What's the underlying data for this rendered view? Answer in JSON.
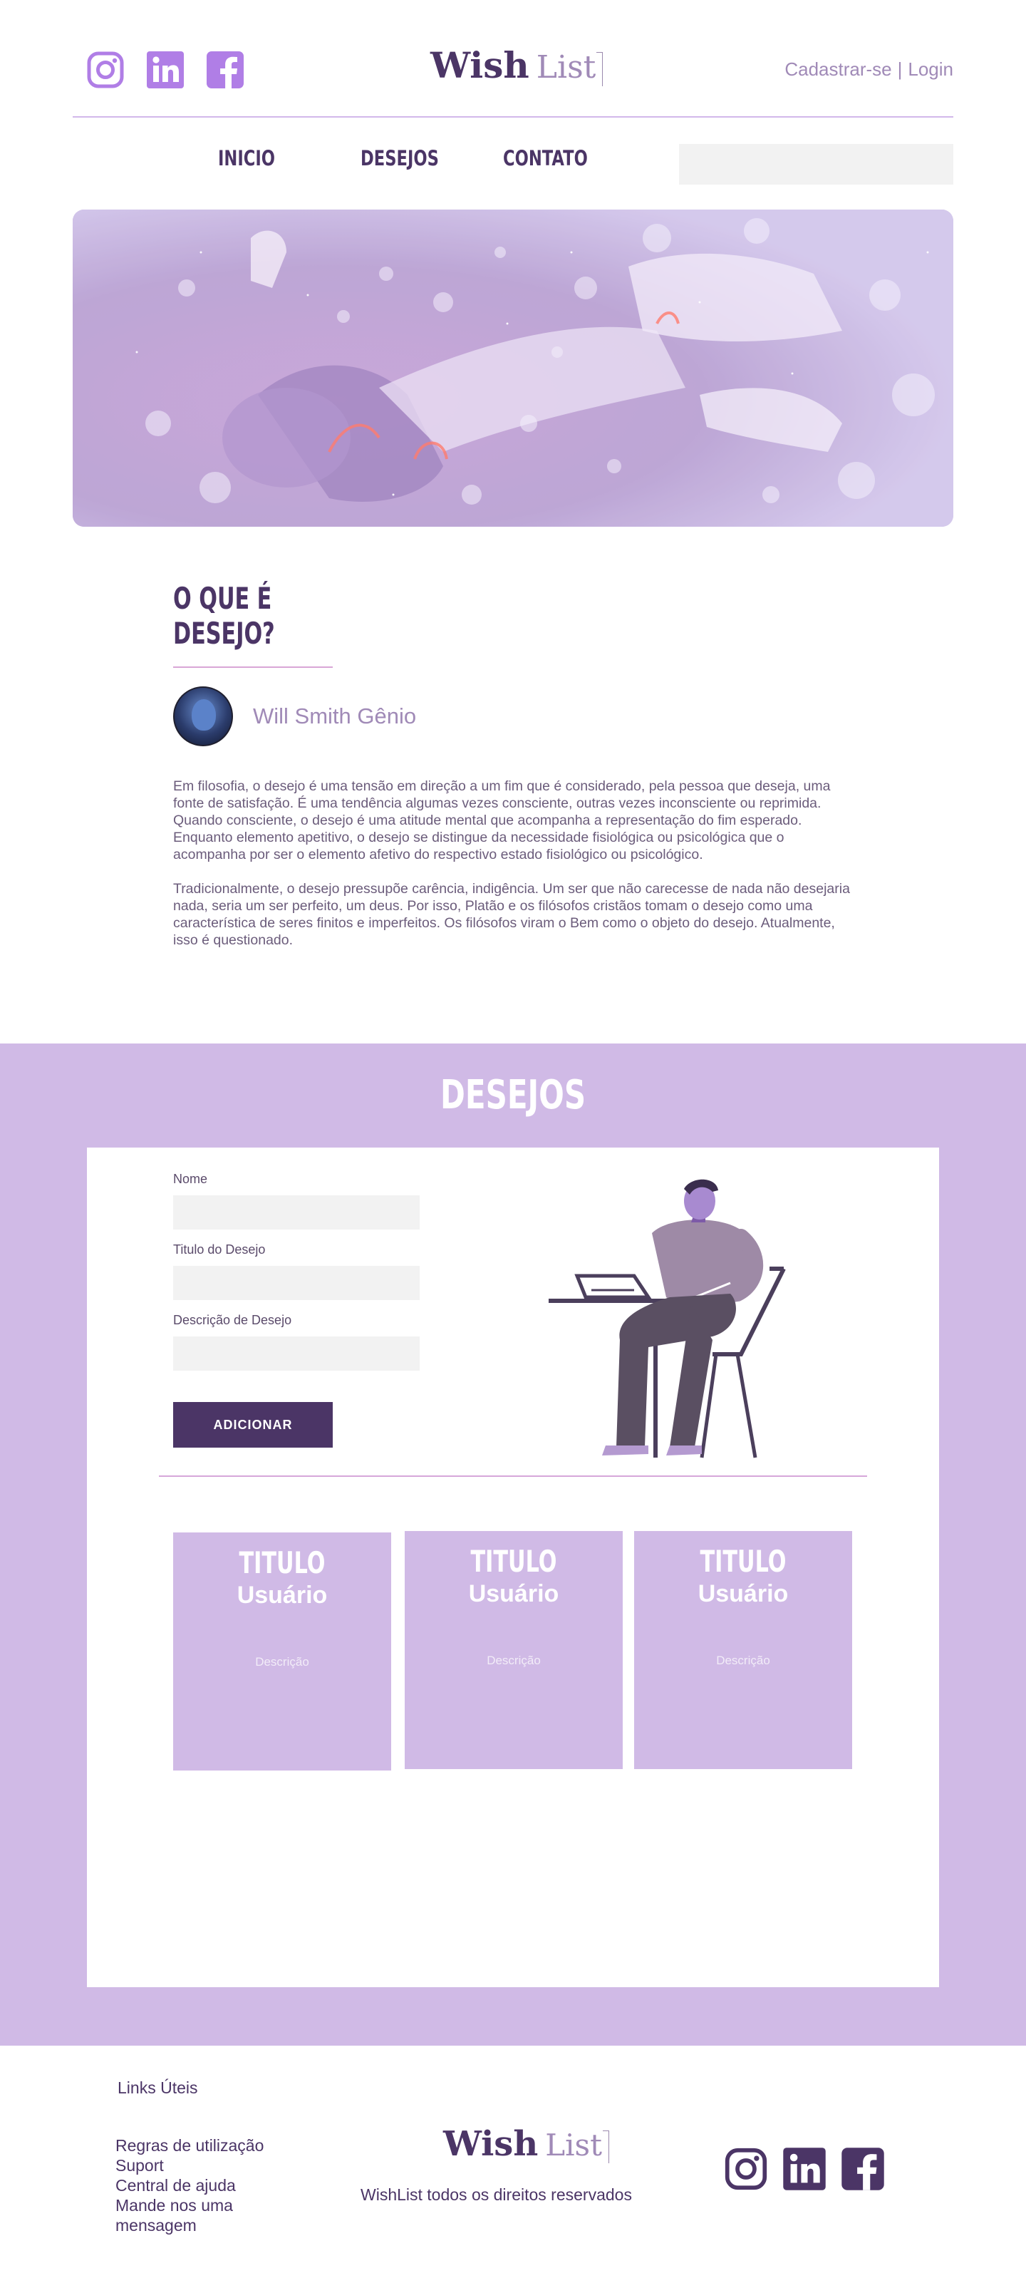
{
  "header": {
    "logo_wish": "Wish",
    "logo_list": "List",
    "auth_signup": "Cadastrar-se",
    "auth_sep": "|",
    "auth_login": "Login",
    "social_icons": [
      "instagram-icon",
      "linkedin-icon",
      "facebook-icon"
    ],
    "social_color": "#b07ee6"
  },
  "nav": {
    "items": [
      {
        "label": "INICIO"
      },
      {
        "label": "DESEJOS"
      },
      {
        "label": "CONTATO"
      }
    ],
    "search_placeholder": ""
  },
  "article": {
    "title": "O QUE É DESEJO?",
    "author": "Will Smith Gênio",
    "paragraphs": [
      "Em filosofia, o desejo é uma tensão em direção a um fim que é considerado, pela pessoa que deseja, uma fonte de satisfação. É uma tendência algumas vezes consciente, outras vezes inconsciente ou reprimida. Quando consciente, o desejo é uma atitude mental que acompanha a representação do fim esperado. Enquanto elemento apetitivo, o desejo se distingue da necessidade fisiológica ou psicológica que o acompanha por ser o elemento afetivo do respectivo estado fisiológico ou psicológico.",
      "Tradicionalmente, o desejo pressupõe carência, indigência. Um ser que não carecesse de nada não desejaria nada, seria um ser perfeito, um deus. Por isso, Platão e os filósofos cristãos tomam o desejo como uma característica de seres finitos e imperfeitos. Os filósofos viram o Bem como o objeto do desejo. Atualmente, isso é questionado."
    ]
  },
  "desejos": {
    "title": "DESEJOS",
    "form": {
      "name_label": "Nome",
      "name_value": "",
      "title_label": "Titulo do Desejo",
      "title_value": "",
      "desc_label": "Descrição de Desejo",
      "desc_value": "",
      "submit_label": "ADICIONAR"
    },
    "cards": [
      {
        "title": "TITULO",
        "user": "Usuário",
        "description": "Descrição"
      },
      {
        "title": "TITULO",
        "user": "Usuário",
        "description": "Descrição"
      },
      {
        "title": "TITULO",
        "user": "Usuário",
        "description": "Descrição"
      }
    ],
    "accent": "#d0bae6",
    "button_color": "#4b3566"
  },
  "footer": {
    "links_title": "Links Úteis",
    "links": [
      "Regras de utilização",
      "Suport",
      "Central de ajuda",
      "Mande nos uma mensagem"
    ],
    "logo_wish": "Wish",
    "logo_list": "List",
    "copyright": "WishList todos os direitos reservados",
    "social_icons": [
      "instagram-icon",
      "linkedin-icon",
      "facebook-icon"
    ],
    "social_color": "#4b3566"
  }
}
